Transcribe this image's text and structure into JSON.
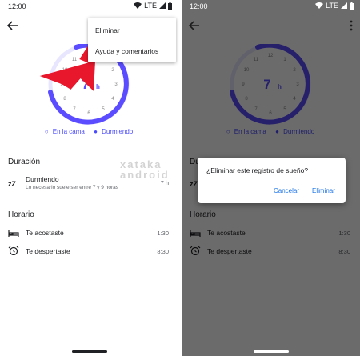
{
  "status_bar": {
    "time": "12:00",
    "network": "LTE"
  },
  "gauge": {
    "hours_value": "7",
    "hours_unit": "h",
    "clock_numbers": [
      "12",
      "1",
      "2",
      "3",
      "4",
      "5",
      "6",
      "7",
      "8",
      "9",
      "10",
      "11"
    ]
  },
  "legend": {
    "in_bed": "En la cama",
    "sleeping": "Durmiendo"
  },
  "duration": {
    "title": "Duración",
    "row": {
      "label": "Durmiendo",
      "sub": "Lo necesario suele ser entre 7 y 9 horas",
      "value": "7 h"
    }
  },
  "schedule": {
    "title": "Horario",
    "bedtime": {
      "label": "Te acostaste",
      "value": "1:30"
    },
    "wake": {
      "label": "Te despertaste",
      "value": "8:30"
    }
  },
  "menu": {
    "delete": "Eliminar",
    "help": "Ayuda y comentarios"
  },
  "dialog": {
    "message": "¿Eliminar este registro de sueño?",
    "cancel": "Cancelar",
    "confirm": "Eliminar"
  },
  "watermark": {
    "line1": "xataka",
    "line2": "android"
  },
  "colors": {
    "accent": "#5b4dff",
    "arrow": "#e8172c",
    "dialog_button": "#1a73e8"
  },
  "icons": [
    "back-arrow-icon",
    "more-vert-icon",
    "wifi-icon",
    "signal-icon",
    "battery-icon",
    "sleep-zz-icon",
    "bed-icon",
    "alarm-clock-icon"
  ]
}
